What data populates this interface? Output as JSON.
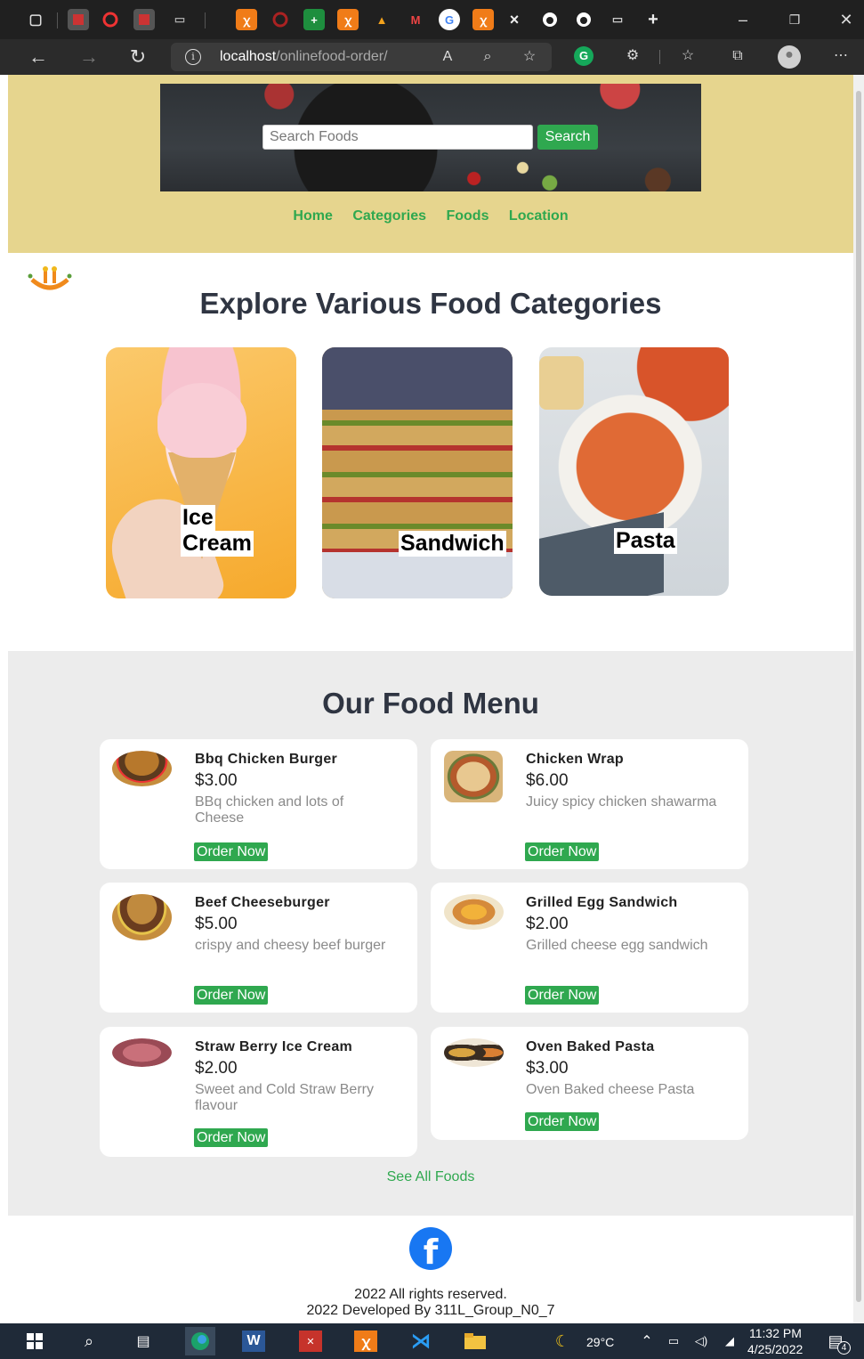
{
  "browser": {
    "url_host": "localhost",
    "url_path": "/onlinefood-order/"
  },
  "header": {
    "search_placeholder": "Search Foods",
    "search_button": "Search",
    "menu": [
      "Home",
      "Categories",
      "Foods",
      "Location"
    ]
  },
  "categories": {
    "title": "Explore Various Food Categories",
    "items": [
      {
        "label_line1": "Ice",
        "label_line2": "Cream"
      },
      {
        "label": "Sandwich"
      },
      {
        "label": "Pasta"
      }
    ]
  },
  "food_menu": {
    "title": "Our Food Menu",
    "items": [
      {
        "name": "Bbq Chicken Burger",
        "price": "$3.00",
        "description": "BBq chicken and lots of Cheese",
        "button": "Order Now"
      },
      {
        "name": "Chicken Wrap",
        "price": "$6.00",
        "description": "Juicy spicy chicken shawarma",
        "button": "Order Now"
      },
      {
        "name": "Beef Cheeseburger",
        "price": "$5.00",
        "description": "crispy and cheesy beef burger",
        "button": "Order Now"
      },
      {
        "name": "Grilled Egg Sandwich",
        "price": "$2.00",
        "description": "Grilled cheese egg sandwich",
        "button": "Order Now"
      },
      {
        "name": "Straw Berry Ice Cream",
        "price": "$2.00",
        "description": "Sweet and Cold Straw Berry flavour",
        "button": "Order Now"
      },
      {
        "name": "Oven Baked Pasta",
        "price": "$3.00",
        "description": "Oven Baked cheese Pasta",
        "button": "Order Now"
      }
    ],
    "see_all": "See All Foods"
  },
  "footer": {
    "rights": "2022 All rights reserved.",
    "developed": "2022 Developed By 311L_Group_N0_7"
  },
  "taskbar": {
    "temperature": "29°C",
    "time": "11:32 PM",
    "date": "4/25/2022",
    "notification_count": "4"
  },
  "colors": {
    "header_bg": "#e6d58e",
    "accent_green": "#2fa84f",
    "title_text": "#2f3542",
    "menu_section_bg": "#ececec"
  }
}
